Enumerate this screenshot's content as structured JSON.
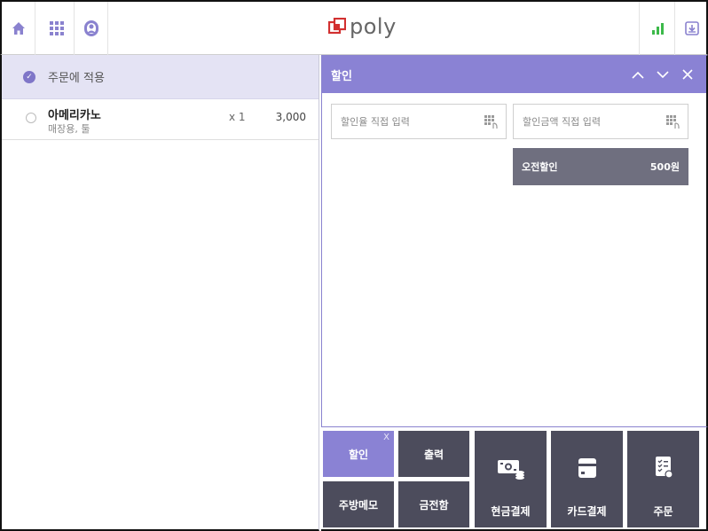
{
  "topbar": {
    "logo_text": "poly",
    "icons": [
      "home-icon",
      "grid-icon",
      "user-icon",
      "signal-icon",
      "download-icon"
    ],
    "accent": "#8a82d4"
  },
  "order_panel": {
    "apply_label": "주문에 적용",
    "items": [
      {
        "name": "아메리카노",
        "options": "매장용, 툴",
        "qty": "x 1",
        "price": "3,000"
      }
    ]
  },
  "discount_panel": {
    "title": "할인",
    "rate_placeholder": "할인율 직접 입력",
    "amount_placeholder": "할인금액 직접 입력",
    "preset": {
      "label": "오전할인",
      "amount": "500원"
    }
  },
  "actions": {
    "discount": "할인",
    "discount_close": "X",
    "print": "출력",
    "kitchen_memo": "주방메모",
    "cash_drawer": "금전함",
    "cash_pay": "현금결제",
    "card_pay": "카드결제",
    "order": "주문"
  }
}
